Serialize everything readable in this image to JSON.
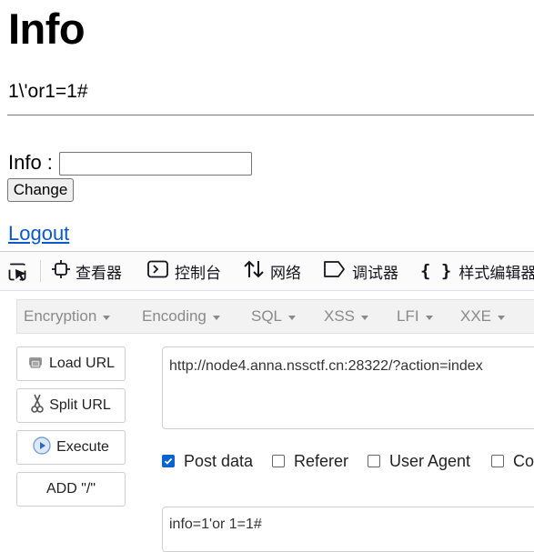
{
  "page": {
    "title": "Info",
    "current_info": "1\\'or1=1#",
    "info_label": "Info :",
    "info_input_value": "",
    "change_button": "Change",
    "logout_link": "Logout"
  },
  "devtools": {
    "tabs": [
      {
        "label": "查看器",
        "icon": "inspector-icon"
      },
      {
        "label": "控制台",
        "icon": "console-icon"
      },
      {
        "label": "网络",
        "icon": "network-icon"
      },
      {
        "label": "调试器",
        "icon": "debugger-icon"
      },
      {
        "label": "样式编辑器",
        "icon": "style-editor-icon"
      }
    ]
  },
  "hackbar": {
    "menu": [
      "Encryption",
      "Encoding",
      "SQL",
      "XSS",
      "LFI",
      "XXE"
    ],
    "buttons": {
      "load_url": "Load URL",
      "split_url": "Split URL",
      "execute": "Execute",
      "add_slash": "ADD \"/\""
    },
    "url": "http://node4.anna.nssctf.cn:28322/?action=index",
    "options": [
      {
        "label": "Post data",
        "checked": true
      },
      {
        "label": "Referer",
        "checked": false
      },
      {
        "label": "User Agent",
        "checked": false
      },
      {
        "label": "Co",
        "checked": false
      }
    ],
    "post_data": "info=1'or 1=1#"
  },
  "colors": {
    "link": "#0a58ca",
    "checkbox_accent": "#0b62d1"
  }
}
